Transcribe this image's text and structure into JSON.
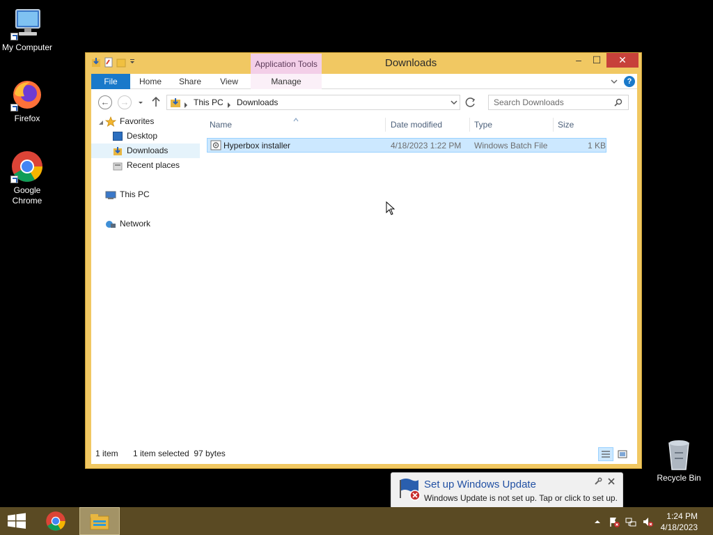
{
  "desktop": {
    "icons": [
      {
        "label": "My Computer"
      },
      {
        "label": "Firefox"
      },
      {
        "label": "Google Chrome"
      },
      {
        "label": "Recycle Bin"
      }
    ]
  },
  "window": {
    "title": "Downloads",
    "context_tab": "Application Tools",
    "controls": {
      "minimize": "–",
      "maximize": "☐",
      "close": "✕"
    },
    "ribbon_tabs": [
      {
        "label": "File"
      },
      {
        "label": "Home"
      },
      {
        "label": "Share"
      },
      {
        "label": "View"
      },
      {
        "label": "Manage"
      }
    ],
    "address": {
      "crumbs": [
        "This PC",
        "Downloads"
      ],
      "search_placeholder": "Search Downloads"
    },
    "nav": {
      "favorites": "Favorites",
      "desktop": "Desktop",
      "downloads": "Downloads",
      "recent": "Recent places",
      "this_pc": "This PC",
      "network": "Network"
    },
    "columns": {
      "name": "Name",
      "date": "Date modified",
      "type": "Type",
      "size": "Size"
    },
    "files": [
      {
        "name": "Hyperbox installer",
        "date": "4/18/2023 1:22 PM",
        "type": "Windows Batch File",
        "size": "1 KB"
      }
    ],
    "status": {
      "count": "1 item",
      "selection": "1 item selected  97 bytes"
    }
  },
  "notification": {
    "title": "Set up Windows Update",
    "body": "Windows Update is not set up. Tap or click to set up."
  },
  "taskbar": {
    "time": "1:24 PM",
    "date": "4/18/2023"
  },
  "colors": {
    "window_frame": "#f1c862",
    "taskbar": "#5a4a23",
    "selection": "#cce8ff",
    "file_tab": "#1979ca",
    "context_tab": "#f3cfe8"
  }
}
